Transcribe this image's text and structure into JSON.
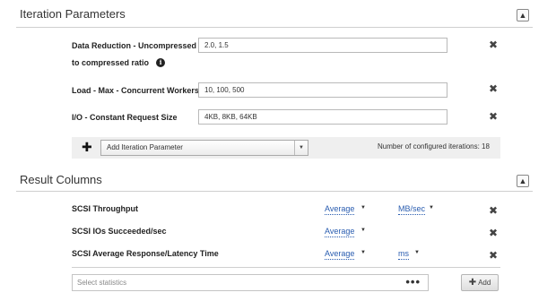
{
  "iteration": {
    "title": "Iteration Parameters",
    "collapse_icon": "double-chevron-up-icon",
    "rows": [
      {
        "label_line1": "Data Reduction - Uncompressed",
        "label_line2": "to compressed ratio",
        "value": "2.0, 1.5",
        "has_info": true
      },
      {
        "label_line1": "Load - Max - Concurrent Workers",
        "value": "10, 100, 500"
      },
      {
        "label_line1": "I/O - Constant Request Size",
        "value": "4KB, 8KB, 64KB"
      }
    ],
    "add_param_placeholder": "Add Iteration Parameter",
    "configured_iterations": "Number of configured iterations: 18"
  },
  "results": {
    "title": "Result Columns",
    "collapse_icon": "double-chevron-up-icon",
    "rows": [
      {
        "label": "SCSI Throughput",
        "stat": "Average",
        "unit": "MB/sec"
      },
      {
        "label": "SCSI IOs Succeeded/sec",
        "stat": "Average",
        "unit": ""
      },
      {
        "label": "SCSI Average Response/Latency Time",
        "stat": "Average",
        "unit": "ms"
      }
    ],
    "stats_placeholder": "Select statistics",
    "more_label": "•••",
    "add_label": "Add"
  },
  "colors": {
    "link": "#2a5db0",
    "band": "#efefef",
    "divider": "#cfcfcf"
  }
}
